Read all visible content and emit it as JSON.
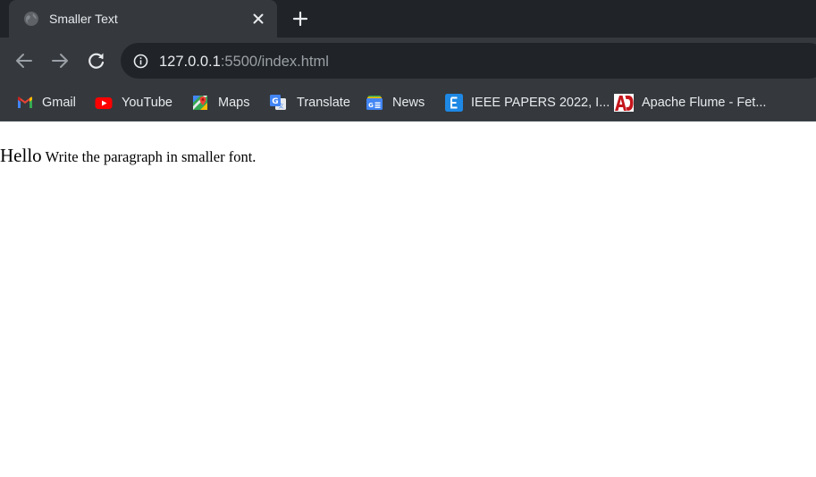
{
  "browser": {
    "tab": {
      "title": "Smaller Text"
    },
    "omnibox": {
      "url_host": "127.0.0.1",
      "url_rest": ":5500/index.html"
    },
    "bookmarks": [
      {
        "label": "Gmail",
        "icon": "gmail-icon"
      },
      {
        "label": "YouTube",
        "icon": "youtube-icon"
      },
      {
        "label": "Maps",
        "icon": "maps-icon"
      },
      {
        "label": "Translate",
        "icon": "translate-icon"
      },
      {
        "label": "News",
        "icon": "news-icon"
      },
      {
        "label": "IEEE PAPERS 2022, I...",
        "icon": "e-letter-icon"
      },
      {
        "label": "Apache Flume - Fet...",
        "icon": "ad-letter-icon"
      }
    ],
    "colors": {
      "frame": "#202428",
      "toolbar": "#35393d",
      "text": "#e8eaed",
      "muted": "#9aa0a6"
    }
  },
  "page": {
    "big_text": "Hello",
    "small_text": "Write the paragraph in smaller font."
  }
}
